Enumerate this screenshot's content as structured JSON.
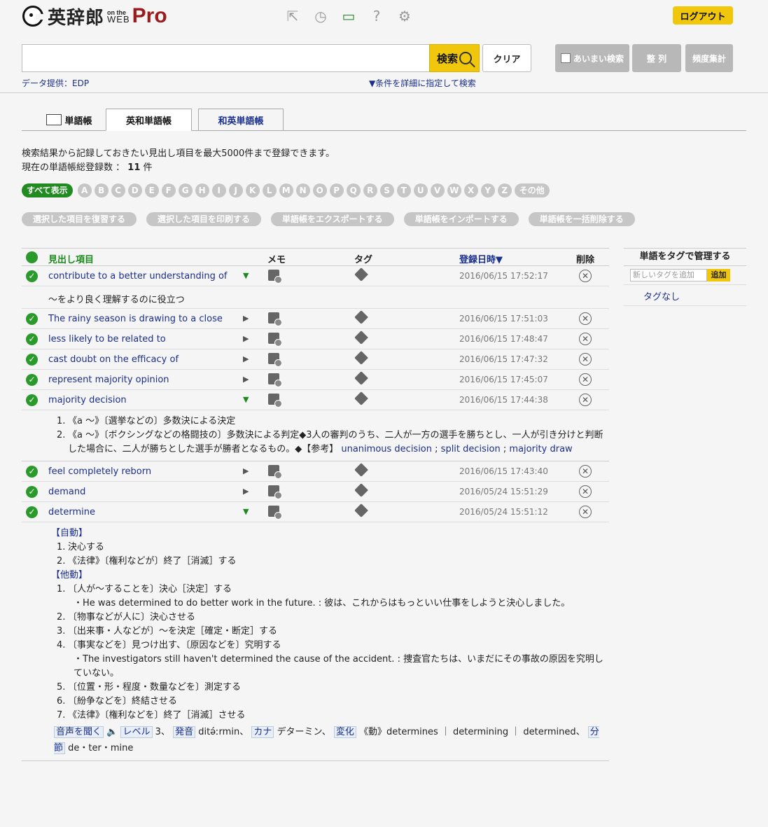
{
  "header": {
    "logo_main": "英辞郎",
    "logo_on_the": "on the",
    "logo_web": "WEB",
    "logo_pro": "Pro",
    "logout": "ログアウト"
  },
  "search": {
    "button": "検索",
    "clear": "クリア",
    "ambiguous": "あいまい検索",
    "sort": "整 列",
    "freq": "頻度集計",
    "data_provider": "データ提供：EDP",
    "detail": "▼条件を詳細に指定して検索"
  },
  "tabs": [
    {
      "label": "単語帳"
    },
    {
      "label": "英和単語帳"
    },
    {
      "label": "和英単語帳"
    }
  ],
  "intro": {
    "line1": "検索結果から記録しておきたい見出し項目を最大5000件まで登録できます。",
    "line2_prefix": "現在の単語帳総登録数 ：",
    "count": "11",
    "unit": "件"
  },
  "alphabet": {
    "all": "すべて表示",
    "letters": [
      "A",
      "B",
      "C",
      "D",
      "E",
      "F",
      "G",
      "H",
      "I",
      "J",
      "K",
      "L",
      "M",
      "N",
      "O",
      "P",
      "Q",
      "R",
      "S",
      "T",
      "U",
      "V",
      "W",
      "X",
      "Y",
      "Z"
    ],
    "other": "その他"
  },
  "actions": [
    "選択した項目を復習する",
    "選択した項目を印刷する",
    "単語帳をエクスポートする",
    "単語帳をインポートする",
    "単語帳を一括削除する"
  ],
  "table": {
    "headers": {
      "entry": "見出し項目",
      "memo": "メモ",
      "tag": "タグ",
      "date": "登録日時▼",
      "delete": "削除"
    },
    "rows": [
      {
        "word": "contribute to a better understanding of",
        "date": "2016/06/15 17:52:17"
      },
      {
        "word": "The rainy season is drawing to a close",
        "date": "2016/06/15 17:51:03"
      },
      {
        "word": "less likely to be related to",
        "date": "2016/06/15 17:48:47"
      },
      {
        "word": "cast doubt on the efficacy of",
        "date": "2016/06/15 17:47:32"
      },
      {
        "word": "represent majority opinion",
        "date": "2016/06/15 17:45:07"
      },
      {
        "word": "majority decision",
        "date": "2016/06/15 17:44:38"
      },
      {
        "word": "feel completely reborn",
        "date": "2016/06/15 17:43:40"
      },
      {
        "word": "demand",
        "date": "2016/05/24 15:51:29"
      },
      {
        "word": "determine",
        "date": "2016/05/24 15:51:12"
      }
    ],
    "meaning_contribute": "～をより良く理解するのに役立つ",
    "majority": {
      "d1": "《a ～》〔選挙などの〕多数決による決定",
      "d2": "《a ～》〔ボクシングなどの格闘技の〕多数決による判定◆3人の審判のうち、二人が一方の選手を勝ちとし、一人が引き分けと判断した場合に、二人が勝ちとした選手が勝者となるもの。◆【参考】",
      "ref1": "unanimous decision",
      "ref2": "split decision",
      "ref3": "majority draw"
    },
    "determine": {
      "pos1": "【自動】",
      "i1": "決心する",
      "i2": "《法律》〔権利などが〕終了［消滅］する",
      "pos2": "【他動】",
      "t1": "〔人が～することを〕決心［決定］する",
      "t1ex": "・He was determined to do better work in the future. : 彼は、これからはもっといい仕事をしようと決心しました。",
      "t2": "〔物事などが人に〕決心させる",
      "t3": "〔出来事・人などが〕～を決定［確定・断定］する",
      "t4": "〔事実などを〕見つけ出す、〔原因などを〕究明する",
      "t4ex": "・The investigators still haven't determined the cause of the accident. : 捜査官たちは、いまだにその事故の原因を究明していない。",
      "t5": "〔位置・形・程度・数量などを〕測定する",
      "t6": "〔紛争などを〕終結させる",
      "t7": "《法律》〔権利などを〕終了［消滅］させる",
      "audio": "音声を聞く",
      "level_label": "レベル",
      "level": "3、",
      "pron_label": "発音",
      "pron": "ditə́ːrmin、",
      "kana_label": "カナ",
      "kana": "デターミン、",
      "change_label": "変化",
      "change": "《動》determines ｜ determining ｜ determined、",
      "syll_label": "分節",
      "syll": "de・ter・mine"
    }
  },
  "tag_panel": {
    "title": "単語をタグで管理する",
    "placeholder": "新しいタグを追加",
    "add": "追加",
    "none": "タグなし"
  }
}
